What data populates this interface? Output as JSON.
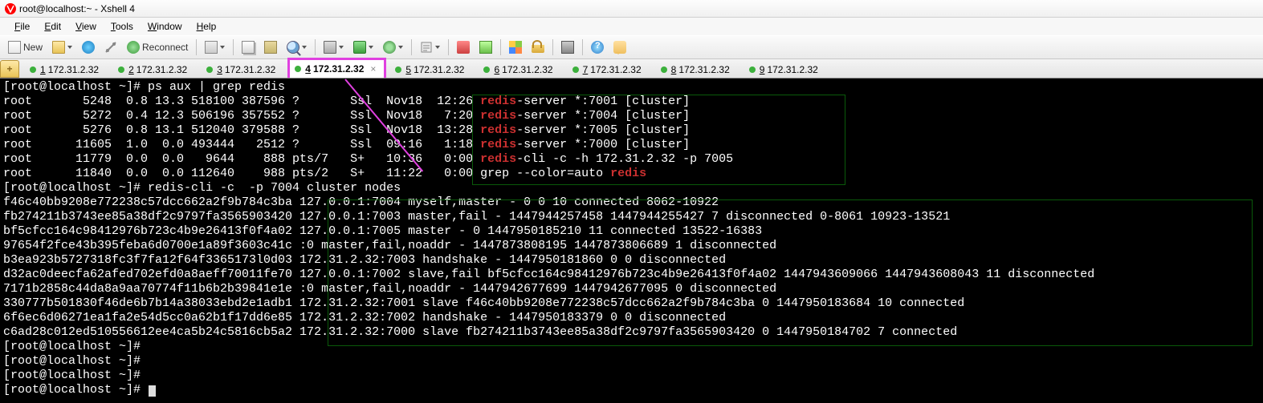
{
  "window": {
    "title": "root@localhost:~ - Xshell 4"
  },
  "menu": {
    "items": [
      "File",
      "Edit",
      "View",
      "Tools",
      "Window",
      "Help"
    ]
  },
  "toolbar": {
    "new_label": "New",
    "reconnect_label": "Reconnect"
  },
  "tabs": {
    "items": [
      {
        "num": "1",
        "label": "172.31.2.32"
      },
      {
        "num": "2",
        "label": "172.31.2.32"
      },
      {
        "num": "3",
        "label": "172.31.2.32"
      },
      {
        "num": "4",
        "label": "172.31.2.32",
        "active": true
      },
      {
        "num": "5",
        "label": "172.31.2.32"
      },
      {
        "num": "6",
        "label": "172.31.2.32"
      },
      {
        "num": "7",
        "label": "172.31.2.32"
      },
      {
        "num": "8",
        "label": "172.31.2.32"
      },
      {
        "num": "9",
        "label": "172.31.2.32"
      }
    ]
  },
  "terminal": {
    "prompt1": "[root@localhost ~]# ",
    "cmd1": "ps aux | grep redis",
    "ps_rows": [
      {
        "l": "root       5248  0.8 13.3 518100 387596 ?       Ssl  Nov18  12:26 ",
        "k": "redis",
        "r": "-server *:7001 [cluster]"
      },
      {
        "l": "root       5272  0.4 12.3 506196 357552 ?       Ssl  Nov18   7:20 ",
        "k": "redis",
        "r": "-server *:7004 [cluster]"
      },
      {
        "l": "root       5276  0.8 13.1 512040 379588 ?       Ssl  Nov18  13:28 ",
        "k": "redis",
        "r": "-server *:7005 [cluster]"
      },
      {
        "l": "root      11605  1.0  0.0 493444   2512 ?       Ssl  09:16   1:18 ",
        "k": "redis",
        "r": "-server *:7000 [cluster]"
      },
      {
        "l": "root      11779  0.0  0.0   9644    888 pts/7   S+   10:36   0:00 ",
        "k": "redis",
        "r": "-cli -c -h 172.31.2.32 -p 7005"
      },
      {
        "l": "root      11840  0.0  0.0 112640    988 pts/2   S+   11:22   0:00 grep --color=auto ",
        "k": "redis",
        "r": ""
      }
    ],
    "prompt2": "[root@localhost ~]# ",
    "cmd2": "redis-cli -c  -p 7004 cluster nodes",
    "cluster_rows": [
      "f46c40bb9208e772238c57dcc662a2f9b784c3ba 127.0.0.1:7004 myself,master - 0 0 10 connected 8062-10922",
      "fb274211b3743ee85a38df2c9797fa3565903420 127.0.0.1:7003 master,fail - 1447944257458 1447944255427 7 disconnected 0-8061 10923-13521",
      "bf5cfcc164c98412976b723c4b9e26413f0f4a02 127.0.0.1:7005 master - 0 1447950185210 11 connected 13522-16383",
      "97654f2fce43b395feba6d0700e1a89f3603c41c :0 master,fail,noaddr - 1447873808195 1447873806689 1 disconnected",
      "b3ea923b5727318fc3f7fa12f64f3365173l0d03 172.31.2.32:7003 handshake - 1447950181860 0 0 disconnected",
      "d32ac0deecfa62afed702efd0a8aeff70011fe70 127.0.0.1:7002 slave,fail bf5cfcc164c98412976b723c4b9e26413f0f4a02 1447943609066 1447943608043 11 disconnected",
      "7171b2858c44da8a9aa70774f11b6b2b39841e1e :0 master,fail,noaddr - 1447942677699 1447942677095 0 disconnected",
      "330777b501830f46de6b7b14a38033ebd2e1adb1 172.31.2.32:7001 slave f46c40bb9208e772238c57dcc662a2f9b784c3ba 0 1447950183684 10 connected",
      "6f6ec6d06271ea1fa2e54d5cc0a62b1f17dd6e85 172.31.2.32:7002 handshake - 1447950183379 0 0 disconnected",
      "c6ad28c012ed510556612ee4ca5b24c5816cb5a2 172.31.2.32:7000 slave fb274211b3743ee85a38df2c9797fa3565903420 0 1447950184702 7 connected"
    ],
    "empty_prompt": "[root@localhost ~]#"
  }
}
